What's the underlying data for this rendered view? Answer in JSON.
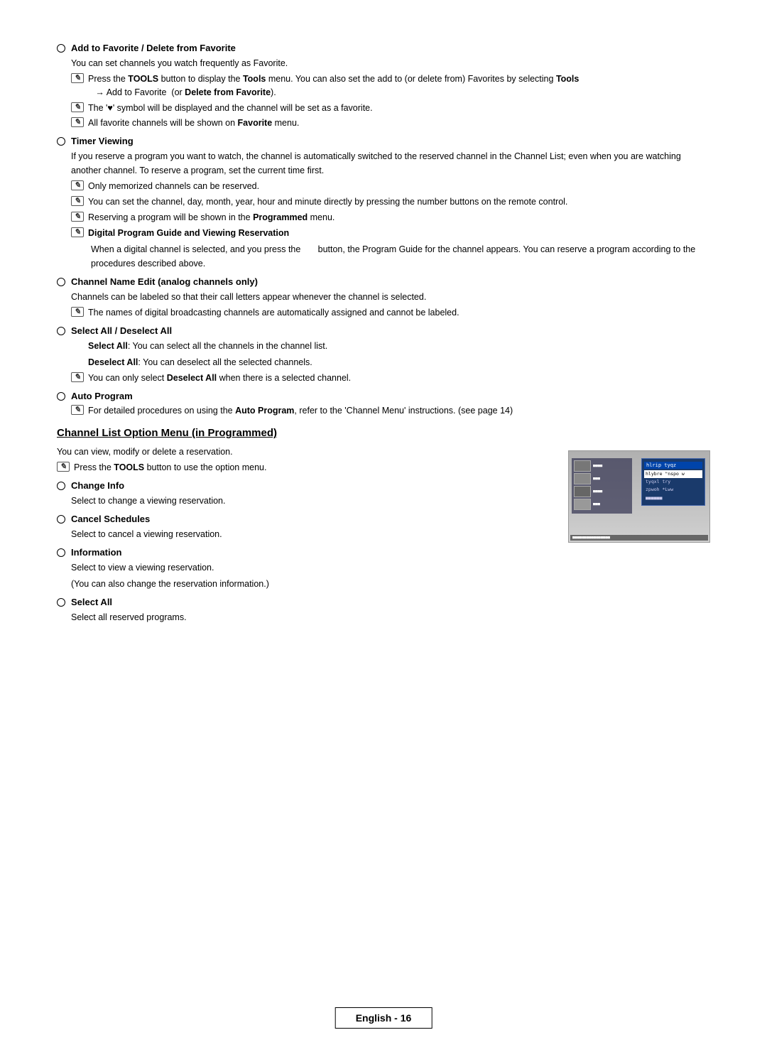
{
  "page": {
    "footer_label": "English - 16"
  },
  "sections": [
    {
      "id": "add-favorite",
      "title": "Add to Favorite / Delete from Favorite",
      "body": "You can set channels you watch frequently as Favorite.",
      "notes": [
        {
          "type": "tools",
          "text": "Press the TOOLS button to display the Tools menu. You can also set the add to (or delete from) Favorites by selecting Tools → Add to Favorite  (or Delete from Favorite)."
        },
        {
          "type": "note",
          "text": "The '♥' symbol will be displayed and the channel will be set as a favorite."
        },
        {
          "type": "note",
          "text": "All favorite channels will be shown on Favorite menu."
        }
      ]
    },
    {
      "id": "timer-viewing",
      "title": "Timer Viewing",
      "body": "If you reserve a program you want to watch, the channel is automatically switched to the reserved channel in the Channel List; even when you are watching another channel. To reserve a program, set the current time first.",
      "notes": [
        {
          "type": "note",
          "text": "Only memorized channels can be reserved."
        },
        {
          "type": "note",
          "text": "You can set the channel, day, month, year, hour and minute directly by pressing the number buttons on the remote control."
        },
        {
          "type": "note",
          "text": "Reserving a program will be shown in the Programmed menu.",
          "bold_words": [
            "Programmed"
          ]
        },
        {
          "type": "sub",
          "title": "Digital Program Guide and Viewing Reservation",
          "text": "When a digital channel is selected, and you press the      button, the Program Guide for the channel appears. You can reserve a program according to the procedures described above."
        }
      ]
    },
    {
      "id": "channel-name-edit",
      "title": "Channel Name Edit (analog channels only)",
      "body": "Channels can be labeled so that their call letters appear whenever the channel is selected.",
      "notes": [
        {
          "type": "note",
          "text": "The names of digital broadcasting channels are automatically assigned and cannot be labeled."
        }
      ]
    },
    {
      "id": "select-all",
      "title": "Select All / Deselect All",
      "items": [
        {
          "bold": "Select All",
          "text": ": You can select all the channels in the channel list."
        },
        {
          "bold": "Deselect All",
          "text": ": You can deselect all the selected channels."
        }
      ],
      "notes": [
        {
          "type": "note",
          "text": "You can only select Deselect All when there is a selected channel.",
          "bold_words": [
            "Deselect All"
          ]
        }
      ]
    },
    {
      "id": "auto-program",
      "title": "Auto Program",
      "notes": [
        {
          "type": "note",
          "text": "For detailed procedures on using the Auto Program, refer to the 'Channel Menu' instructions. (see page 14)",
          "bold_words": [
            "Auto Program"
          ]
        }
      ]
    }
  ],
  "channel_list_section": {
    "heading": "Channel List Option Menu (in Programmed)",
    "intro": "You can view, modify or delete a reservation.",
    "tools_note": "Press the TOOLS button to use the option menu.",
    "sub_items": [
      {
        "id": "change-info",
        "title": "Change Info",
        "body": "Select to change a viewing reservation."
      },
      {
        "id": "cancel-schedules",
        "title": "Cancel Schedules",
        "body": "Select to cancel a viewing reservation."
      },
      {
        "id": "information",
        "title": "Information",
        "body": "Select to view a viewing reservation.",
        "sub_body": "(You can also change the reservation information.)"
      },
      {
        "id": "select-all",
        "title": "Select All",
        "body": "Select all reserved programs."
      }
    ]
  }
}
